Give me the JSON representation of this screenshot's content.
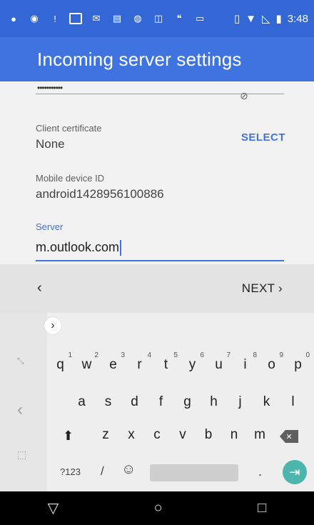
{
  "status_bar": {
    "time": "3:48",
    "icons": [
      "messenger-icon",
      "spotify-icon",
      "alert-icon",
      "image-icon",
      "gmail-icon",
      "news-icon",
      "vpn-icon",
      "outlook-icon",
      "hangouts-icon",
      "mail-icon",
      "vibrate-icon",
      "wifi-icon",
      "no-signal-icon",
      "battery-icon"
    ]
  },
  "app_bar": {
    "title": "Incoming server settings"
  },
  "form": {
    "password_masked": "•••••••••••",
    "client_certificate_label": "Client certificate",
    "client_certificate_value": "None",
    "select_label": "SELECT",
    "mobile_device_id_label": "Mobile device ID",
    "mobile_device_id_value": "android1428956100886",
    "server_label": "Server",
    "server_value": "m.outlook.com"
  },
  "navigation": {
    "back_symbol": "‹",
    "next_label": "NEXT ›"
  },
  "keyboard": {
    "row1": [
      {
        "k": "q",
        "n": "1"
      },
      {
        "k": "w",
        "n": "2"
      },
      {
        "k": "e",
        "n": "3"
      },
      {
        "k": "r",
        "n": "4"
      },
      {
        "k": "t",
        "n": "5"
      },
      {
        "k": "y",
        "n": "6"
      },
      {
        "k": "u",
        "n": "7"
      },
      {
        "k": "i",
        "n": "8"
      },
      {
        "k": "o",
        "n": "9"
      },
      {
        "k": "p",
        "n": "0"
      }
    ],
    "row2": [
      "a",
      "s",
      "d",
      "f",
      "g",
      "h",
      "j",
      "k",
      "l"
    ],
    "row3": [
      "z",
      "x",
      "c",
      "v",
      "b",
      "n",
      "m"
    ],
    "symbols_label": "?123",
    "slash_label": "/",
    "period_label": "."
  },
  "system_nav": {
    "back": "▽",
    "home": "○",
    "recents": "□"
  }
}
